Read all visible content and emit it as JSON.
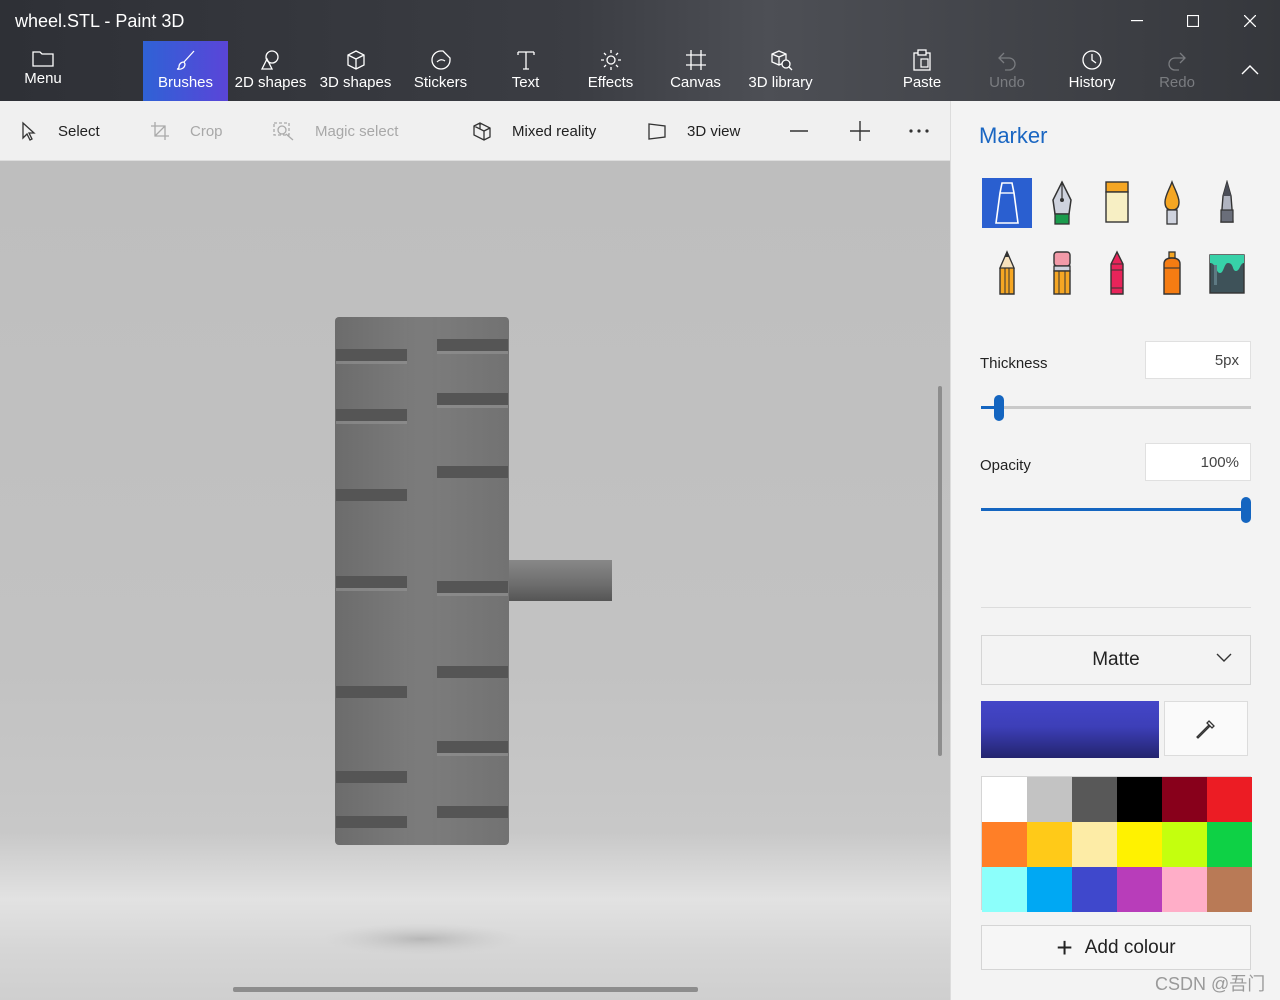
{
  "window": {
    "title": "wheel.STL - Paint 3D"
  },
  "ribbon": {
    "menu": "Menu",
    "brushes": "Brushes",
    "shapes_2d": "2D shapes",
    "shapes_3d": "3D shapes",
    "stickers": "Stickers",
    "text": "Text",
    "effects": "Effects",
    "canvas": "Canvas",
    "library_3d": "3D library",
    "paste": "Paste",
    "undo": "Undo",
    "history": "History",
    "redo": "Redo"
  },
  "toolbar": {
    "select": "Select",
    "crop": "Crop",
    "magic_select": "Magic select",
    "mixed_reality": "Mixed reality",
    "view_3d": "3D view"
  },
  "panel": {
    "title": "Marker",
    "brush_tools": [
      "marker-icon",
      "calligraphy-pen-icon",
      "oil-brush-icon",
      "watercolor-icon",
      "pixel-pen-icon",
      "pencil-icon",
      "eraser-icon",
      "crayon-icon",
      "spraycan-icon",
      "fill-icon"
    ],
    "thickness_label": "Thickness",
    "thickness_value": "5px",
    "thickness_level": 0.05,
    "opacity_label": "Opacity",
    "opacity_value": "100%",
    "opacity_level": 1.0,
    "finish": "Matte",
    "current_color": "#4446c8",
    "palette": [
      "#ffffff",
      "#c3c3c3",
      "#585858",
      "#000000",
      "#88001b",
      "#ec1c24",
      "#ff7f27",
      "#ffca18",
      "#fdeca6",
      "#fff200",
      "#c4ff0e",
      "#0ed145",
      "#8cfffb",
      "#00a8f3",
      "#3f48cc",
      "#b83dba",
      "#ffaec8",
      "#b97a56"
    ],
    "add_colour": "Add colour"
  },
  "watermark": "CSDN @吾门"
}
